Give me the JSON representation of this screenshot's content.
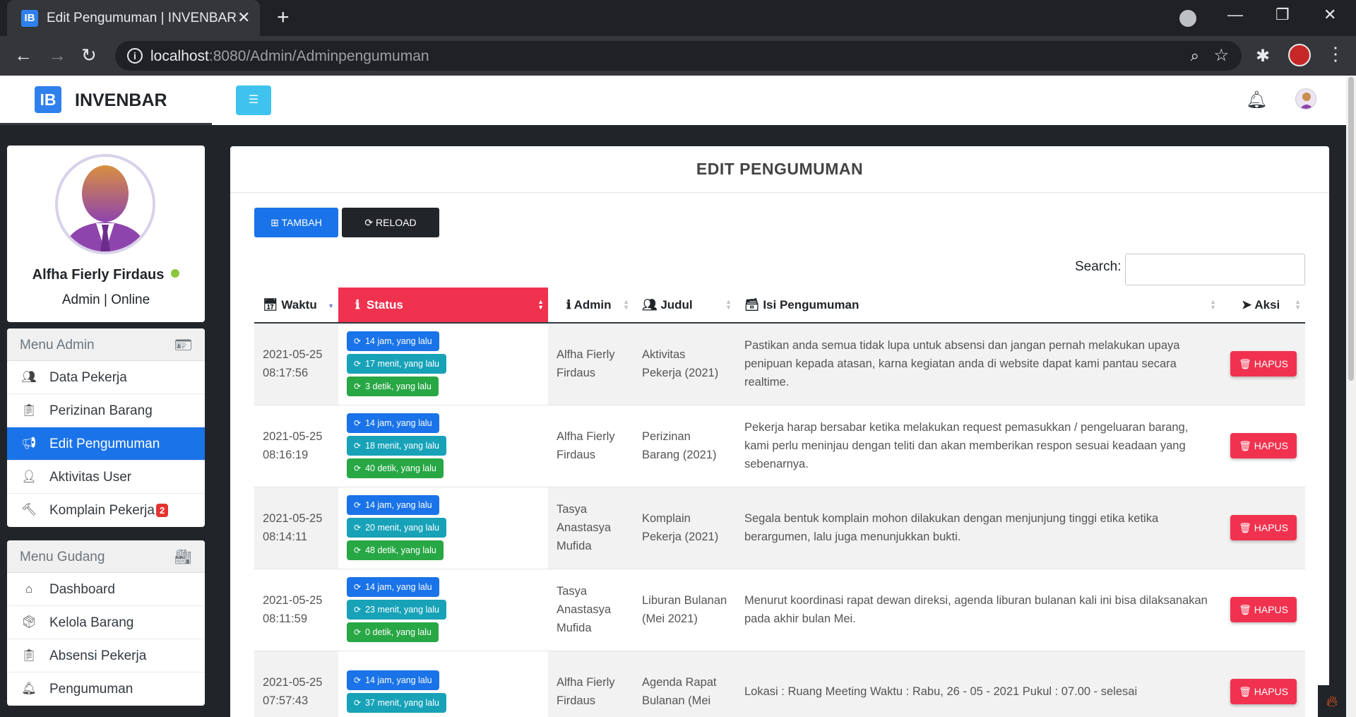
{
  "browser": {
    "tab_title": "Edit Pengumuman | INVENBAR",
    "favicon_text": "IB",
    "url_host": "localhost",
    "url_rest": ":8080/Admin/Adminpengumuman"
  },
  "brand": {
    "logo_text": "IB",
    "name": "INVENBAR"
  },
  "user": {
    "name": "Alfha Fierly Firdaus",
    "role": "Admin | Online"
  },
  "menu_admin": {
    "title": "Menu Admin",
    "items": [
      {
        "label": "Data Pekerja",
        "icon": "users-icon"
      },
      {
        "label": "Perizinan Barang",
        "icon": "clipboard-icon"
      },
      {
        "label": "Edit Pengumuman",
        "icon": "megaphone-icon",
        "active": true
      },
      {
        "label": "Aktivitas User",
        "icon": "user-tie-icon"
      },
      {
        "label": "Komplain Pekerja",
        "icon": "gavel-icon",
        "badge": "2"
      }
    ]
  },
  "menu_gudang": {
    "title": "Menu Gudang",
    "items": [
      {
        "label": "Dashboard",
        "icon": "home-icon"
      },
      {
        "label": "Kelola Barang",
        "icon": "box-icon"
      },
      {
        "label": "Absensi Pekerja",
        "icon": "clipboard-icon"
      },
      {
        "label": "Pengumuman",
        "icon": "bell-icon"
      }
    ]
  },
  "page": {
    "title": "EDIT PENGUMUMAN",
    "add_label": "TAMBAH",
    "reload_label": "RELOAD",
    "search_label": "Search:",
    "search_value": ""
  },
  "table": {
    "headers": {
      "waktu": "Waktu",
      "status": "Status",
      "admin": "Admin",
      "judul": "Judul",
      "isi": "Isi Pengumuman",
      "aksi": "Aksi"
    },
    "delete_label": "HAPUS",
    "rows": [
      {
        "date": "2021-05-25",
        "time": "08:17:56",
        "s1": "14 jam, yang lalu",
        "s2": "17 menit, yang lalu",
        "s3": "3 detik, yang lalu",
        "admin": "Alfha Fierly Firdaus",
        "judul": "Aktivitas Pekerja (2021)",
        "isi": "Pastikan anda semua tidak lupa untuk absensi dan jangan pernah melakukan upaya penipuan kepada atasan, karna kegiatan anda di website dapat kami pantau secara realtime."
      },
      {
        "date": "2021-05-25",
        "time": "08:16:19",
        "s1": "14 jam, yang lalu",
        "s2": "18 menit, yang lalu",
        "s3": "40 detik, yang lalu",
        "admin": "Alfha Fierly Firdaus",
        "judul": "Perizinan Barang (2021)",
        "isi": "Pekerja harap bersabar ketika melakukan request pemasukkan / pengeluaran barang, kami perlu meninjau dengan teliti dan akan memberikan respon sesuai keadaan yang sebenarnya."
      },
      {
        "date": "2021-05-25",
        "time": "08:14:11",
        "s1": "14 jam, yang lalu",
        "s2": "20 menit, yang lalu",
        "s3": "48 detik, yang lalu",
        "admin": "Tasya Anastasya Mufida",
        "judul": "Komplain Pekerja (2021)",
        "isi": "Segala bentuk komplain mohon dilakukan dengan menjunjung tinggi etika ketika berargumen, lalu juga menunjukkan bukti."
      },
      {
        "date": "2021-05-25",
        "time": "08:11:59",
        "s1": "14 jam, yang lalu",
        "s2": "23 menit, yang lalu",
        "s3": "0 detik, yang lalu",
        "admin": "Tasya Anastasya Mufida",
        "judul": "Liburan Bulanan (Mei 2021)",
        "isi": "Menurut koordinasi rapat dewan direksi, agenda liburan bulanan kali ini bisa dilaksanakan pada akhir bulan Mei."
      },
      {
        "date": "2021-05-25",
        "time": "07:57:43",
        "s1": "14 jam, yang lalu",
        "s2": "37 menit, yang lalu",
        "s3": "",
        "admin": "Alfha Fierly Firdaus",
        "judul": "Agenda Rapat Bulanan (Mei",
        "isi": "Lokasi : Ruang Meeting Waktu : Rabu, 26 - 05 - 2021 Pukul : 07.00 - selesai"
      }
    ]
  },
  "colors": {
    "primary": "#1a73e8",
    "danger": "#f0324f",
    "info": "#17a2b8",
    "success": "#28a745",
    "toggle": "#3fc3ee"
  }
}
